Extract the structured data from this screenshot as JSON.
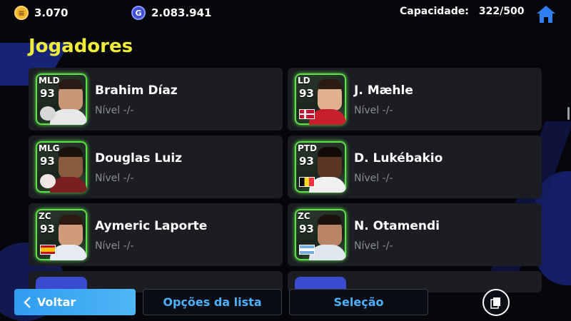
{
  "header": {
    "gold_coins": "3.070",
    "gp_points": "2.083.941",
    "gp_icon_letter": "G",
    "capacity_label": "Capacidade:",
    "capacity_value": "322/500"
  },
  "section_title": "Jogadores",
  "players": [
    {
      "position": "MLD",
      "overall": "93",
      "name": "Brahim Díaz",
      "level": "Nível -/-",
      "icon": "club-badge-icon"
    },
    {
      "position": "LD",
      "overall": "93",
      "name": "J. Mæhle",
      "level": "Nível -/-",
      "icon": "denmark-flag-icon"
    },
    {
      "position": "MLG",
      "overall": "93",
      "name": "Douglas Luiz",
      "level": "Nível -/-",
      "icon": "club-badge-icon"
    },
    {
      "position": "PTD",
      "overall": "93",
      "name": "D. Lukébakio",
      "level": "Nível -/-",
      "icon": "belgium-flag-icon"
    },
    {
      "position": "ZC",
      "overall": "93",
      "name": "Aymeric Laporte",
      "level": "Nível -/-",
      "icon": "spain-flag-icon"
    },
    {
      "position": "ZC",
      "overall": "93",
      "name": "N. Otamendi",
      "level": "Nível -/-",
      "icon": "argentina-flag-icon"
    }
  ],
  "footer": {
    "back_label": "Voltar",
    "list_options_label": "Opções da lista",
    "selection_label": "Seleção"
  },
  "colors": {
    "accent_yellow": "#f1ec3a",
    "accent_blue": "#4cb2ff",
    "card_glow": "#5fe04a"
  }
}
